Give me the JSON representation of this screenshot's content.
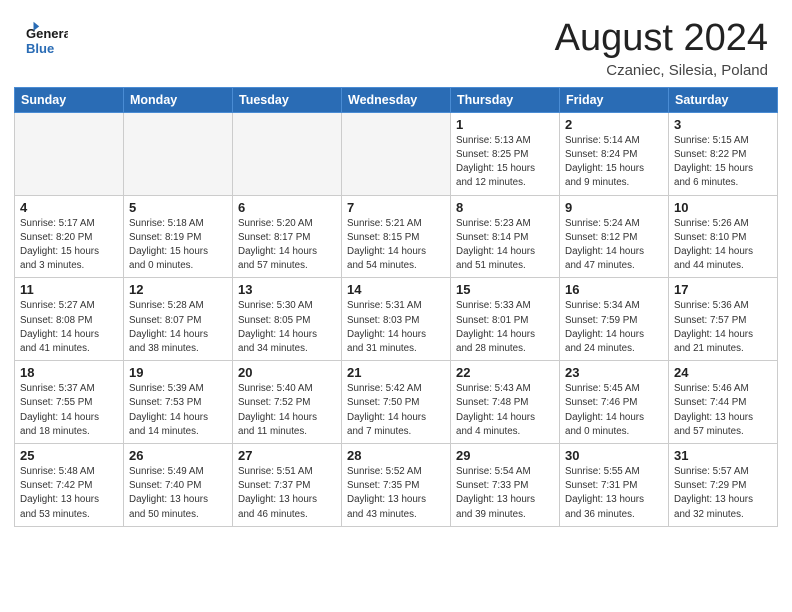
{
  "header": {
    "logo_line1": "General",
    "logo_line2": "Blue",
    "month": "August 2024",
    "location": "Czaniec, Silesia, Poland"
  },
  "weekdays": [
    "Sunday",
    "Monday",
    "Tuesday",
    "Wednesday",
    "Thursday",
    "Friday",
    "Saturday"
  ],
  "weeks": [
    [
      {
        "day": "",
        "detail": ""
      },
      {
        "day": "",
        "detail": ""
      },
      {
        "day": "",
        "detail": ""
      },
      {
        "day": "",
        "detail": ""
      },
      {
        "day": "1",
        "detail": "Sunrise: 5:13 AM\nSunset: 8:25 PM\nDaylight: 15 hours\nand 12 minutes."
      },
      {
        "day": "2",
        "detail": "Sunrise: 5:14 AM\nSunset: 8:24 PM\nDaylight: 15 hours\nand 9 minutes."
      },
      {
        "day": "3",
        "detail": "Sunrise: 5:15 AM\nSunset: 8:22 PM\nDaylight: 15 hours\nand 6 minutes."
      }
    ],
    [
      {
        "day": "4",
        "detail": "Sunrise: 5:17 AM\nSunset: 8:20 PM\nDaylight: 15 hours\nand 3 minutes."
      },
      {
        "day": "5",
        "detail": "Sunrise: 5:18 AM\nSunset: 8:19 PM\nDaylight: 15 hours\nand 0 minutes."
      },
      {
        "day": "6",
        "detail": "Sunrise: 5:20 AM\nSunset: 8:17 PM\nDaylight: 14 hours\nand 57 minutes."
      },
      {
        "day": "7",
        "detail": "Sunrise: 5:21 AM\nSunset: 8:15 PM\nDaylight: 14 hours\nand 54 minutes."
      },
      {
        "day": "8",
        "detail": "Sunrise: 5:23 AM\nSunset: 8:14 PM\nDaylight: 14 hours\nand 51 minutes."
      },
      {
        "day": "9",
        "detail": "Sunrise: 5:24 AM\nSunset: 8:12 PM\nDaylight: 14 hours\nand 47 minutes."
      },
      {
        "day": "10",
        "detail": "Sunrise: 5:26 AM\nSunset: 8:10 PM\nDaylight: 14 hours\nand 44 minutes."
      }
    ],
    [
      {
        "day": "11",
        "detail": "Sunrise: 5:27 AM\nSunset: 8:08 PM\nDaylight: 14 hours\nand 41 minutes."
      },
      {
        "day": "12",
        "detail": "Sunrise: 5:28 AM\nSunset: 8:07 PM\nDaylight: 14 hours\nand 38 minutes."
      },
      {
        "day": "13",
        "detail": "Sunrise: 5:30 AM\nSunset: 8:05 PM\nDaylight: 14 hours\nand 34 minutes."
      },
      {
        "day": "14",
        "detail": "Sunrise: 5:31 AM\nSunset: 8:03 PM\nDaylight: 14 hours\nand 31 minutes."
      },
      {
        "day": "15",
        "detail": "Sunrise: 5:33 AM\nSunset: 8:01 PM\nDaylight: 14 hours\nand 28 minutes."
      },
      {
        "day": "16",
        "detail": "Sunrise: 5:34 AM\nSunset: 7:59 PM\nDaylight: 14 hours\nand 24 minutes."
      },
      {
        "day": "17",
        "detail": "Sunrise: 5:36 AM\nSunset: 7:57 PM\nDaylight: 14 hours\nand 21 minutes."
      }
    ],
    [
      {
        "day": "18",
        "detail": "Sunrise: 5:37 AM\nSunset: 7:55 PM\nDaylight: 14 hours\nand 18 minutes."
      },
      {
        "day": "19",
        "detail": "Sunrise: 5:39 AM\nSunset: 7:53 PM\nDaylight: 14 hours\nand 14 minutes."
      },
      {
        "day": "20",
        "detail": "Sunrise: 5:40 AM\nSunset: 7:52 PM\nDaylight: 14 hours\nand 11 minutes."
      },
      {
        "day": "21",
        "detail": "Sunrise: 5:42 AM\nSunset: 7:50 PM\nDaylight: 14 hours\nand 7 minutes."
      },
      {
        "day": "22",
        "detail": "Sunrise: 5:43 AM\nSunset: 7:48 PM\nDaylight: 14 hours\nand 4 minutes."
      },
      {
        "day": "23",
        "detail": "Sunrise: 5:45 AM\nSunset: 7:46 PM\nDaylight: 14 hours\nand 0 minutes."
      },
      {
        "day": "24",
        "detail": "Sunrise: 5:46 AM\nSunset: 7:44 PM\nDaylight: 13 hours\nand 57 minutes."
      }
    ],
    [
      {
        "day": "25",
        "detail": "Sunrise: 5:48 AM\nSunset: 7:42 PM\nDaylight: 13 hours\nand 53 minutes."
      },
      {
        "day": "26",
        "detail": "Sunrise: 5:49 AM\nSunset: 7:40 PM\nDaylight: 13 hours\nand 50 minutes."
      },
      {
        "day": "27",
        "detail": "Sunrise: 5:51 AM\nSunset: 7:37 PM\nDaylight: 13 hours\nand 46 minutes."
      },
      {
        "day": "28",
        "detail": "Sunrise: 5:52 AM\nSunset: 7:35 PM\nDaylight: 13 hours\nand 43 minutes."
      },
      {
        "day": "29",
        "detail": "Sunrise: 5:54 AM\nSunset: 7:33 PM\nDaylight: 13 hours\nand 39 minutes."
      },
      {
        "day": "30",
        "detail": "Sunrise: 5:55 AM\nSunset: 7:31 PM\nDaylight: 13 hours\nand 36 minutes."
      },
      {
        "day": "31",
        "detail": "Sunrise: 5:57 AM\nSunset: 7:29 PM\nDaylight: 13 hours\nand 32 minutes."
      }
    ]
  ]
}
